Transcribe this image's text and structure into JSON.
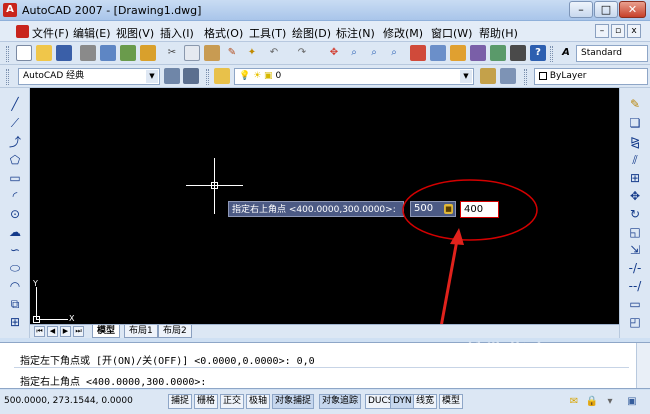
{
  "window": {
    "title": "AutoCAD 2007 - [Drawing1.dwg]",
    "logo": "A",
    "minimize": "–",
    "maximize": "□",
    "close": "✕"
  },
  "menubar": {
    "items": [
      "文件(F)",
      "编辑(E)",
      "视图(V)",
      "插入(I)",
      "格式(O)",
      "工具(T)",
      "绘图(D)",
      "标注(N)",
      "修改(M)",
      "窗口(W)",
      "帮助(H)"
    ],
    "mdi_min": "–",
    "mdi_restore": "▫",
    "mdi_close": "x"
  },
  "toolbar1": {
    "text_style": "Standard",
    "text_style_icon": "A"
  },
  "toolbar2": {
    "workspace": "AutoCAD 经典",
    "layer": "0",
    "color": "ByLayer"
  },
  "command_prompt": {
    "label": "指定右上角点 <400.0000,300.0000>:",
    "x_value": "500",
    "y_value": "400"
  },
  "ucs": {
    "x_label": "X",
    "y_label": "Y"
  },
  "tabs": {
    "model": "模型",
    "layout1": "布局1",
    "layout2": "布局2"
  },
  "command_history": [
    "指定左下角点或 [开(ON)/关(OFF)] <0.0000,0.0000>: 0,0",
    "指定右上角点 <400.0000,300.0000>:"
  ],
  "status": {
    "coords": "500.0000, 273.1544, 0.0000",
    "buttons": [
      "捕捉",
      "栅格",
      "正交",
      "极轴",
      "对象捕捉",
      "对象追踪",
      "DUCS",
      "DYN",
      "线宽",
      "模型"
    ]
  },
  "watermark": {
    "text": "搜狗指南",
    "sub": "zhinan.sogou.com"
  },
  "colors": {
    "canvas": "#000000",
    "highlight": "#d40000",
    "prompt_bg": "#4c5a84"
  }
}
